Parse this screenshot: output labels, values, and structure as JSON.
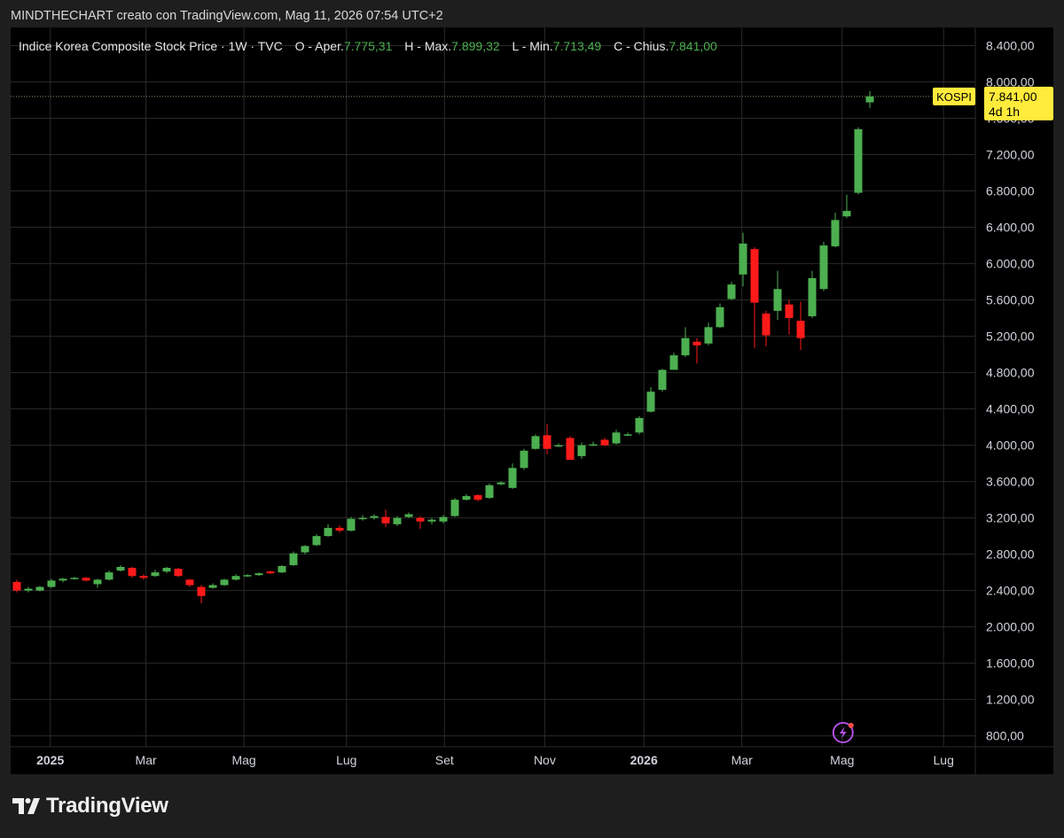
{
  "caption": "MINDTHECHART creato con TradingView.com, Mag 11, 2026 07:54 UTC+2",
  "legend": {
    "title": "Indice Korea Composite Stock Price · 1W · TVC",
    "o_label": "O - Aper.",
    "o_value": "7.775,31",
    "h_label": "H - Max.",
    "h_value": "7.899,32",
    "l_label": "L - Min.",
    "l_value": "7.713,49",
    "c_label": "C - Chius.",
    "c_value": "7.841,00"
  },
  "price_badge": {
    "symbol": "KOSPI",
    "price": "7.841,00",
    "countdown": "4d 1h"
  },
  "footer": {
    "brand": "TradingView"
  },
  "colors": {
    "up": "#4caf50",
    "down": "#ff1a1a",
    "badge": "#ffeb3b",
    "grid": "#2a2a2a",
    "background": "#000000"
  },
  "chart_data": {
    "type": "candlestick",
    "timeframe": "1W",
    "symbol": "KOSPI",
    "ylim": [
      680,
      8600
    ],
    "y_ticks": [
      {
        "value": 800,
        "label": "800,00"
      },
      {
        "value": 1200,
        "label": "1.200,00"
      },
      {
        "value": 1600,
        "label": "1.600,00"
      },
      {
        "value": 2000,
        "label": "2.000,00"
      },
      {
        "value": 2400,
        "label": "2.400,00"
      },
      {
        "value": 2800,
        "label": "2.800,00"
      },
      {
        "value": 3200,
        "label": "3.200,00"
      },
      {
        "value": 3600,
        "label": "3.600,00"
      },
      {
        "value": 4000,
        "label": "4.000,00"
      },
      {
        "value": 4400,
        "label": "4.400,00"
      },
      {
        "value": 4800,
        "label": "4.800,00"
      },
      {
        "value": 5200,
        "label": "5.200,00"
      },
      {
        "value": 5600,
        "label": "5.600,00"
      },
      {
        "value": 6000,
        "label": "6.000,00"
      },
      {
        "value": 6400,
        "label": "6.400,00"
      },
      {
        "value": 6800,
        "label": "6.800,00"
      },
      {
        "value": 7200,
        "label": "7.200,00"
      },
      {
        "value": 7600,
        "label": "7.600,00"
      },
      {
        "value": 8000,
        "label": "8.000,00"
      },
      {
        "value": 8400,
        "label": "8.400,00"
      }
    ],
    "x_ticks": [
      {
        "index": 2.9,
        "label": "2025",
        "bold": true
      },
      {
        "index": 11.2,
        "label": "Mar",
        "bold": false
      },
      {
        "index": 19.7,
        "label": "Mag",
        "bold": false
      },
      {
        "index": 28.6,
        "label": "Lug",
        "bold": false
      },
      {
        "index": 37.1,
        "label": "Set",
        "bold": false
      },
      {
        "index": 45.8,
        "label": "Nov",
        "bold": false
      },
      {
        "index": 54.4,
        "label": "2026",
        "bold": true
      },
      {
        "index": 62.9,
        "label": "Mar",
        "bold": false
      },
      {
        "index": 71.6,
        "label": "Mag",
        "bold": false
      },
      {
        "index": 80.4,
        "label": "Lug",
        "bold": false
      }
    ],
    "candles": [
      [
        2495,
        2520,
        2380,
        2400
      ],
      [
        2400,
        2440,
        2380,
        2420
      ],
      [
        2400,
        2450,
        2390,
        2440
      ],
      [
        2440,
        2530,
        2430,
        2510
      ],
      [
        2510,
        2540,
        2490,
        2530
      ],
      [
        2530,
        2550,
        2520,
        2540
      ],
      [
        2540,
        2550,
        2500,
        2510
      ],
      [
        2470,
        2530,
        2430,
        2520
      ],
      [
        2520,
        2620,
        2510,
        2600
      ],
      [
        2620,
        2680,
        2610,
        2660
      ],
      [
        2650,
        2660,
        2540,
        2560
      ],
      [
        2560,
        2580,
        2520,
        2540
      ],
      [
        2560,
        2630,
        2550,
        2600
      ],
      [
        2610,
        2660,
        2590,
        2650
      ],
      [
        2640,
        2650,
        2550,
        2560
      ],
      [
        2520,
        2530,
        2440,
        2460
      ],
      [
        2440,
        2460,
        2260,
        2340
      ],
      [
        2430,
        2480,
        2420,
        2460
      ],
      [
        2460,
        2530,
        2450,
        2520
      ],
      [
        2520,
        2580,
        2510,
        2560
      ],
      [
        2560,
        2580,
        2550,
        2570
      ],
      [
        2570,
        2600,
        2560,
        2590
      ],
      [
        2610,
        2620,
        2580,
        2590
      ],
      [
        2600,
        2680,
        2590,
        2670
      ],
      [
        2680,
        2830,
        2670,
        2810
      ],
      [
        2820,
        2900,
        2800,
        2890
      ],
      [
        2900,
        3020,
        2890,
        3000
      ],
      [
        3000,
        3130,
        2990,
        3090
      ],
      [
        3090,
        3120,
        3040,
        3060
      ],
      [
        3060,
        3210,
        3050,
        3190
      ],
      [
        3190,
        3230,
        3170,
        3200
      ],
      [
        3200,
        3240,
        3180,
        3220
      ],
      [
        3210,
        3290,
        3100,
        3140
      ],
      [
        3130,
        3220,
        3110,
        3200
      ],
      [
        3210,
        3260,
        3200,
        3240
      ],
      [
        3200,
        3220,
        3080,
        3160
      ],
      [
        3160,
        3200,
        3130,
        3180
      ],
      [
        3160,
        3230,
        3140,
        3210
      ],
      [
        3220,
        3420,
        3210,
        3400
      ],
      [
        3400,
        3460,
        3390,
        3440
      ],
      [
        3450,
        3460,
        3380,
        3400
      ],
      [
        3420,
        3580,
        3410,
        3560
      ],
      [
        3570,
        3600,
        3560,
        3590
      ],
      [
        3530,
        3800,
        3520,
        3750
      ],
      [
        3750,
        3960,
        3730,
        3940
      ],
      [
        3960,
        4120,
        3950,
        4100
      ],
      [
        4110,
        4230,
        3900,
        3960
      ],
      [
        4000,
        4020,
        3980,
        4000
      ],
      [
        4080,
        4100,
        3850,
        3840
      ],
      [
        3880,
        4030,
        3850,
        4000
      ],
      [
        4000,
        4040,
        3990,
        4010
      ],
      [
        4060,
        4080,
        3990,
        4000
      ],
      [
        4020,
        4170,
        4010,
        4140
      ],
      [
        4110,
        4140,
        4100,
        4120
      ],
      [
        4140,
        4320,
        4120,
        4300
      ],
      [
        4370,
        4640,
        4360,
        4590
      ],
      [
        4610,
        4840,
        4590,
        4830
      ],
      [
        4830,
        5020,
        4850,
        4990
      ],
      [
        4990,
        5300,
        4970,
        5180
      ],
      [
        5140,
        5180,
        4900,
        5100
      ],
      [
        5120,
        5350,
        5100,
        5300
      ],
      [
        5300,
        5560,
        5290,
        5520
      ],
      [
        5610,
        5800,
        5600,
        5770
      ],
      [
        5880,
        6340,
        5750,
        6220
      ],
      [
        6160,
        6180,
        5070,
        5570
      ],
      [
        5450,
        5480,
        5090,
        5210
      ],
      [
        5480,
        5920,
        5380,
        5720
      ],
      [
        5550,
        5600,
        5220,
        5400
      ],
      [
        5370,
        5580,
        5050,
        5180
      ],
      [
        5420,
        5920,
        5400,
        5840
      ],
      [
        5720,
        6240,
        5700,
        6200
      ],
      [
        6190,
        6560,
        6180,
        6480
      ],
      [
        6520,
        6760,
        6500,
        6580
      ],
      [
        6780,
        7500,
        6760,
        7480
      ],
      [
        7775.31,
        7899.32,
        7713.49,
        7841
      ]
    ]
  }
}
